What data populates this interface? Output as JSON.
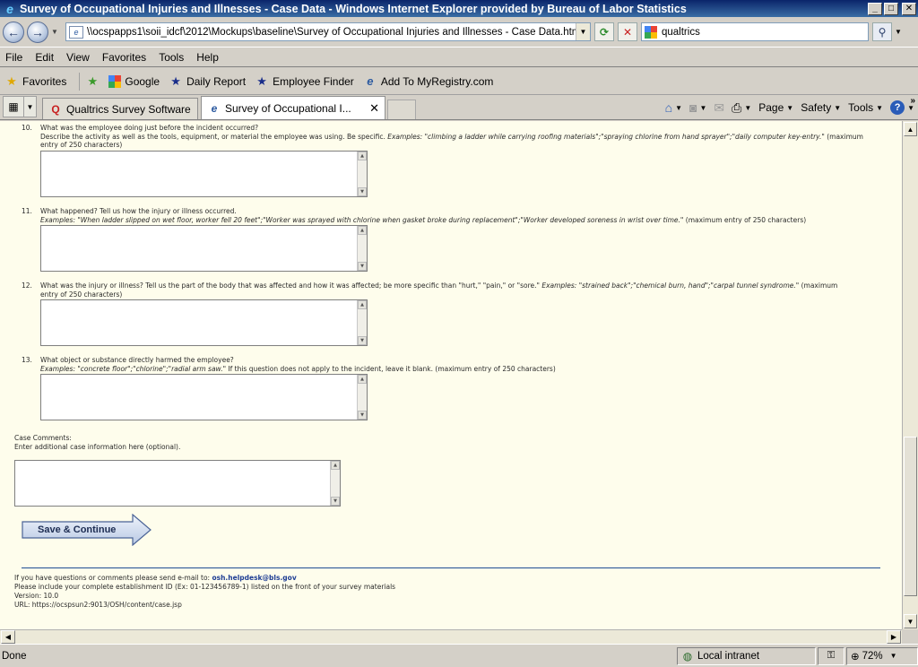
{
  "window": {
    "title": "Survey of Occupational Injuries and Illnesses - Case Data - Windows Internet Explorer provided by Bureau of Labor Statistics",
    "minimize": "_",
    "maximize": "□",
    "close": "✕"
  },
  "address": {
    "url": "\\\\ocspapps1\\soii_idcf\\2012\\Mockups\\baseline\\Survey of Occupational Injuries and Illnesses - Case Data.htm",
    "search_value": "qualtrics"
  },
  "menu": [
    "File",
    "Edit",
    "View",
    "Favorites",
    "Tools",
    "Help"
  ],
  "favorites_bar": {
    "favorites_label": "Favorites",
    "links": [
      {
        "label": "Google",
        "icon": "google-icon"
      },
      {
        "label": "Daily Report",
        "icon": "star-icon"
      },
      {
        "label": "Employee Finder",
        "icon": "star-icon"
      },
      {
        "label": "Add To MyRegistry.com",
        "icon": "ie-page-icon"
      }
    ]
  },
  "tabs": [
    {
      "label": "Qualtrics Survey Software",
      "active": false
    },
    {
      "label": "Survey of Occupational I...",
      "active": true
    }
  ],
  "command_bar": {
    "page": "Page",
    "safety": "Safety",
    "tools": "Tools"
  },
  "questions": [
    {
      "num": "10.",
      "text": "What was the employee doing just before the incident occurred?",
      "desc": "Describe the activity as well as the tools, equipment, or material the employee was using. Be specific.",
      "examples": "Examples: \"climbing a ladder while carrying roofing materials\";\"spraying chlorine from hand sprayer\";\"daily computer key-entry.\"",
      "tail": "(maximum entry of 250 characters)"
    },
    {
      "num": "11.",
      "text": "What happened? Tell us how the injury or illness occurred.",
      "desc": "",
      "examples": "Examples: \"When ladder slipped on wet floor, worker fell 20 feet\";\"Worker was sprayed with chlorine when gasket broke during replacement\";\"Worker developed soreness in wrist over time.\"",
      "tail": "(maximum entry of 250 characters)"
    },
    {
      "num": "12.",
      "text": "What was the injury or illness? Tell us the part of the body that was affected and how it was affected; be more specific than \"hurt,\" \"pain,\" or \"sore.\"",
      "desc": "",
      "examples": "Examples: \"strained back\";\"chemical burn, hand\";\"carpal tunnel syndrome.\"",
      "tail": "(maximum entry of 250 characters)"
    },
    {
      "num": "13.",
      "text": "What object or substance directly harmed the employee?",
      "desc": "",
      "examples": "Examples: \"concrete floor\";\"chlorine\";\"radial arm saw.\"",
      "tail": "If this question does not apply to the incident, leave it blank. (maximum entry of 250 characters)"
    }
  ],
  "comments": {
    "label": "Case Comments:",
    "hint": "Enter additional case information here (optional)."
  },
  "save_button": "Save & Continue",
  "footer": {
    "line1_prefix": "If you have questions or comments please send e-mail to:",
    "email": "osh.helpdesk@bls.gov",
    "line2": "Please include your complete establishment ID (Ex: 01-123456789-1) listed on the front of your survey materials",
    "version": "Version: 10.0",
    "url": "URL: https://ocspsun2:9013/OSH/content/case.jsp"
  },
  "status": {
    "text": "Done",
    "zone": "Local intranet",
    "zoom": "72%"
  },
  "colors": {
    "content_bg": "#fefdec",
    "link": "#1f3e94",
    "titlebar": "#0a246a"
  }
}
